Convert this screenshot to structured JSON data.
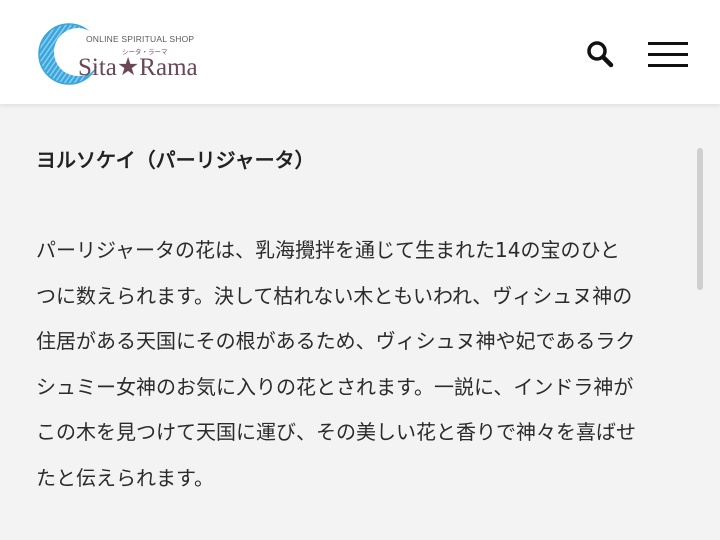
{
  "header": {
    "logo": {
      "tagline": "ONLINE SPIRITUAL SHOP",
      "kana": "シータ・ラーマ",
      "name": "Sita★Rama"
    },
    "search_icon": "search-icon",
    "menu_icon": "hamburger-menu-icon"
  },
  "article": {
    "heading": "ヨルソケイ（パーリジャータ）",
    "lines": [
      "パーリジャータの花は、乳海攪拌を通じて生まれた14の宝のひと",
      "つに数えられます。決して枯れない木ともいわれ、ヴィシュヌ神の",
      "住居がある天国にその根があるため、ヴィシュヌ神や妃であるラク",
      "シュミー女神のお気に入りの花とされます。一説に、インドラ神が",
      "この木を見つけて天国に運び、その美しい花と香りで神々を喜ばせ",
      "たと伝えられます。"
    ]
  },
  "colors": {
    "logo_blue": "#3aa6dc",
    "logo_text": "#6a4657",
    "background": "#f3f3f3",
    "header_bg": "#ffffff"
  }
}
